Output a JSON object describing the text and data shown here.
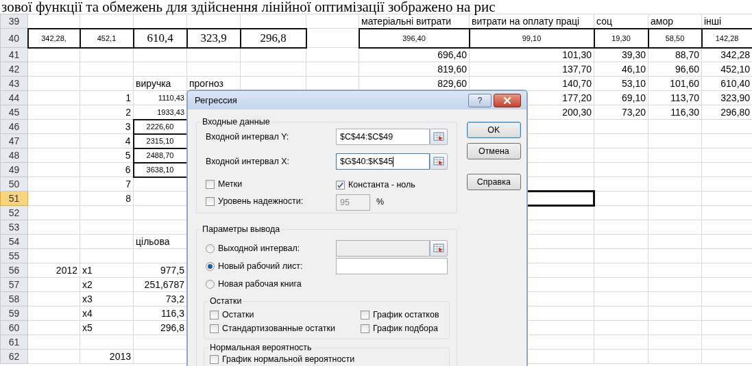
{
  "document_text": "зової функції та обмежень для здійснення лінійної оптимізації зображено на рис",
  "sheet": {
    "rows": [
      {
        "number": "39",
        "selected": false,
        "cells": [
          null,
          null,
          null,
          null,
          null,
          null,
          {
            "text": "матеріальні витрати",
            "kind": "label",
            "boxed": false
          },
          {
            "text": "витрати на оплату праці",
            "kind": "label",
            "boxed": false
          },
          {
            "text": "соц",
            "kind": "label",
            "boxed": false
          },
          {
            "text": "амор",
            "kind": "label",
            "boxed": false
          },
          {
            "text": "інші",
            "kind": "label",
            "boxed": false
          }
        ]
      },
      {
        "number": "40",
        "selected": false,
        "cells": [
          {
            "text": "342,28,",
            "kind": "small",
            "boxed": true
          },
          {
            "text": "452,1",
            "kind": "small",
            "boxed": true
          },
          {
            "text": "610,4",
            "kind": "serif",
            "boxed": true
          },
          {
            "text": "323,9",
            "kind": "serif",
            "boxed": true
          },
          {
            "text": "296,8",
            "kind": "serif",
            "boxed": true
          },
          null,
          {
            "text": "396,40",
            "kind": "small",
            "boxed": true
          },
          {
            "text": "99,10",
            "kind": "small",
            "boxed": true
          },
          {
            "text": "19,30",
            "kind": "small",
            "boxed": true
          },
          {
            "text": "58,50",
            "kind": "small",
            "boxed": true
          },
          {
            "text": "142,28",
            "kind": "small",
            "boxed": true
          }
        ]
      },
      {
        "number": "41",
        "selected": false,
        "cells": [
          null,
          null,
          null,
          null,
          null,
          null,
          {
            "text": "696,40",
            "kind": "number",
            "boxed": false
          },
          {
            "text": "101,30",
            "kind": "number",
            "boxed": false
          },
          {
            "text": "39,30",
            "kind": "number",
            "boxed": false
          },
          {
            "text": "88,70",
            "kind": "number",
            "boxed": false
          },
          {
            "text": "342,28",
            "kind": "number",
            "boxed": false
          }
        ]
      },
      {
        "number": "42",
        "selected": false,
        "cells": [
          null,
          null,
          null,
          null,
          null,
          null,
          {
            "text": "819,60",
            "kind": "number",
            "boxed": false
          },
          {
            "text": "137,70",
            "kind": "number",
            "boxed": false
          },
          {
            "text": "46,10",
            "kind": "number",
            "boxed": false
          },
          {
            "text": "96,60",
            "kind": "number",
            "boxed": false
          },
          {
            "text": "452,10",
            "kind": "number",
            "boxed": false
          }
        ]
      },
      {
        "number": "43",
        "selected": false,
        "cells": [
          null,
          null,
          {
            "text": "виручка",
            "kind": "label",
            "boxed": false
          },
          {
            "text": "прогноз",
            "kind": "label",
            "boxed": false
          },
          null,
          null,
          {
            "text": "829,60",
            "kind": "number",
            "boxed": false
          },
          {
            "text": "140,70",
            "kind": "number",
            "boxed": false
          },
          {
            "text": "53,10",
            "kind": "number",
            "boxed": false
          },
          {
            "text": "101,60",
            "kind": "number",
            "boxed": false
          },
          {
            "text": "610,40",
            "kind": "number",
            "boxed": false
          }
        ]
      },
      {
        "number": "44",
        "selected": false,
        "cells": [
          null,
          {
            "text": "1",
            "kind": "number",
            "boxed": false
          },
          {
            "text": "1110,43",
            "kind": "small-right",
            "boxed": false
          },
          null,
          null,
          null,
          null,
          {
            "text": "177,20",
            "kind": "number",
            "boxed": false
          },
          {
            "text": "69,10",
            "kind": "number",
            "boxed": false
          },
          {
            "text": "113,70",
            "kind": "number",
            "boxed": false
          },
          {
            "text": "323,90",
            "kind": "number",
            "boxed": false
          }
        ]
      },
      {
        "number": "45",
        "selected": false,
        "cells": [
          null,
          {
            "text": "2",
            "kind": "number",
            "boxed": false
          },
          {
            "text": "1933,43",
            "kind": "small-right",
            "boxed": false
          },
          null,
          null,
          null,
          null,
          {
            "text": "200,30",
            "kind": "number",
            "boxed": false
          },
          {
            "text": "73,20",
            "kind": "number",
            "boxed": false
          },
          {
            "text": "116,30",
            "kind": "number",
            "boxed": false
          },
          {
            "text": "296,80",
            "kind": "number",
            "boxed": false
          }
        ]
      },
      {
        "number": "46",
        "selected": false,
        "cells": [
          null,
          {
            "text": "3",
            "kind": "number",
            "boxed": false
          },
          {
            "text": "2226,60",
            "kind": "small",
            "boxed": true
          }
        ]
      },
      {
        "number": "47",
        "selected": false,
        "cells": [
          null,
          {
            "text": "4",
            "kind": "number",
            "boxed": false
          },
          {
            "text": "2315,10",
            "kind": "small",
            "boxed": true
          }
        ]
      },
      {
        "number": "48",
        "selected": false,
        "cells": [
          null,
          {
            "text": "5",
            "kind": "number",
            "boxed": false
          },
          {
            "text": "2488,70",
            "kind": "small",
            "boxed": true
          }
        ]
      },
      {
        "number": "49",
        "selected": false,
        "cells": [
          null,
          {
            "text": "6",
            "kind": "number",
            "boxed": false
          },
          {
            "text": "3638,10",
            "kind": "small",
            "boxed": true
          }
        ]
      },
      {
        "number": "50",
        "selected": false,
        "cells": [
          null,
          {
            "text": "7",
            "kind": "number",
            "boxed": false
          }
        ]
      },
      {
        "number": "51",
        "selected": true,
        "cells": [
          null,
          {
            "text": "8",
            "kind": "number",
            "boxed": false
          },
          null,
          null,
          null,
          null,
          null,
          {
            "selected": true
          }
        ]
      },
      {
        "number": "52",
        "selected": false,
        "cells": []
      },
      {
        "number": "53",
        "selected": false,
        "cells": []
      },
      {
        "number": "54",
        "selected": false,
        "cells": [
          null,
          null,
          {
            "text": "цільова",
            "kind": "label",
            "boxed": false
          }
        ]
      },
      {
        "number": "55",
        "selected": false,
        "cells": []
      },
      {
        "number": "56",
        "selected": false,
        "cells": [
          {
            "text": "2012",
            "kind": "number",
            "boxed": false
          },
          {
            "text": "x1",
            "kind": "label",
            "boxed": false
          },
          {
            "text": "977,5",
            "kind": "number",
            "boxed": false
          }
        ]
      },
      {
        "number": "57",
        "selected": false,
        "cells": [
          null,
          {
            "text": "x2",
            "kind": "label",
            "boxed": false
          },
          {
            "text": "251,6787",
            "kind": "number",
            "boxed": false
          }
        ]
      },
      {
        "number": "58",
        "selected": false,
        "cells": [
          null,
          {
            "text": "x3",
            "kind": "label",
            "boxed": false
          },
          {
            "text": "73,2",
            "kind": "number",
            "boxed": false
          }
        ]
      },
      {
        "number": "59",
        "selected": false,
        "cells": [
          null,
          {
            "text": "x4",
            "kind": "label",
            "boxed": false
          },
          {
            "text": "116,3",
            "kind": "number",
            "boxed": false
          }
        ]
      },
      {
        "number": "60",
        "selected": false,
        "cells": [
          null,
          {
            "text": "x5",
            "kind": "label",
            "boxed": false
          },
          {
            "text": "296,8",
            "kind": "number",
            "boxed": false
          }
        ]
      },
      {
        "number": "61",
        "selected": false,
        "cells": []
      },
      {
        "number": "62",
        "selected": false,
        "cells": [
          null,
          {
            "text": "2013",
            "kind": "number",
            "boxed": false
          }
        ]
      }
    ]
  },
  "dialog": {
    "title": "Регрессия",
    "help_button": "?",
    "input_group": {
      "title": "Входные данные",
      "fields": [
        {
          "label": "Входной интервал Y:",
          "value": "$C$44:$C$49",
          "focused": false
        },
        {
          "label": "Входной интервал X:",
          "value": "$G$40:$K$45",
          "focused": true
        }
      ],
      "options": [
        {
          "label": "Метки",
          "checked": false
        },
        {
          "label": "Константа - ноль",
          "checked": true
        },
        {
          "label": "Уровень надежности:",
          "checked": false
        }
      ],
      "confidence": {
        "value": "95",
        "disabled": true,
        "unit": "%"
      }
    },
    "buttons": [
      {
        "label": "OK",
        "default": true
      },
      {
        "label": "Отмена",
        "default": false
      },
      {
        "label": "Справка",
        "default": false
      }
    ],
    "output_group": {
      "title": "Параметры вывода",
      "choices": [
        {
          "label": "Выходной интервал:",
          "selected": false,
          "field": {
            "kind": "range",
            "disabled": true
          }
        },
        {
          "label": "Новый рабочий лист:",
          "selected": true,
          "field": {
            "kind": "text",
            "disabled": false
          }
        },
        {
          "label": "Новая рабочая книга",
          "selected": false
        }
      ],
      "residuals": {
        "title": "Остатки",
        "options": [
          {
            "label": "Остатки",
            "checked": false
          },
          {
            "label": "График остатков",
            "checked": false
          },
          {
            "label": "Стандартизованные остатки",
            "checked": false
          },
          {
            "label": "График подбора",
            "checked": false
          }
        ]
      },
      "normal": {
        "title": "Нормальная вероятность",
        "options": [
          {
            "label": "График нормальной вероятности",
            "checked": false
          }
        ]
      }
    }
  }
}
